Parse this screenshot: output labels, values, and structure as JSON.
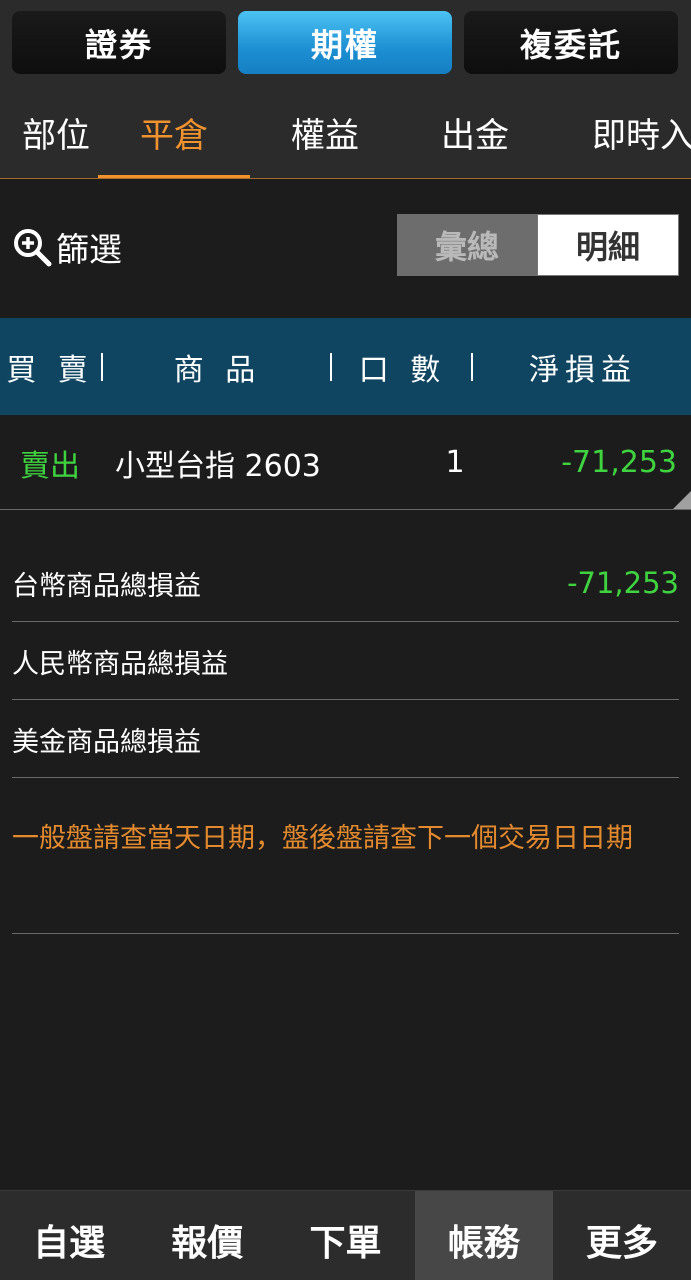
{
  "top_segments": [
    {
      "label": "證券",
      "active": false
    },
    {
      "label": "期權",
      "active": true
    },
    {
      "label": "複委託",
      "active": false
    }
  ],
  "tabs": [
    {
      "label": "部位",
      "active": false
    },
    {
      "label": "平倉",
      "active": true
    },
    {
      "label": "權益",
      "active": false
    },
    {
      "label": "出金",
      "active": false
    },
    {
      "label": "即時入",
      "active": false
    }
  ],
  "filter": {
    "label": "篩選",
    "icon": "zoom-in-icon"
  },
  "view_toggle": {
    "summary_label": "彙總",
    "detail_label": "明細",
    "selected": "detail"
  },
  "table": {
    "headers": [
      "買 賣",
      "商 品",
      "口 數",
      "淨損益"
    ],
    "rows": [
      {
        "side": "賣出",
        "product": "小型台指 2603",
        "qty": "1",
        "pnl": "-71,253"
      }
    ]
  },
  "summary": [
    {
      "label": "台幣商品總損益",
      "value": "-71,253"
    },
    {
      "label": "人民幣商品總損益",
      "value": ""
    },
    {
      "label": "美金商品總損益",
      "value": ""
    }
  ],
  "notice": "一般盤請查當天日期，盤後盤請查下一個交易日日期",
  "bottom_nav": [
    {
      "label": "自選",
      "active": false
    },
    {
      "label": "報價",
      "active": false
    },
    {
      "label": "下單",
      "active": false
    },
    {
      "label": "帳務",
      "active": true
    },
    {
      "label": "更多",
      "active": false
    }
  ],
  "colors": {
    "accent_orange": "#f0922e",
    "active_blue": "#1d8fd3",
    "loss_green": "#3fd43f",
    "header_teal": "#0f4560"
  }
}
